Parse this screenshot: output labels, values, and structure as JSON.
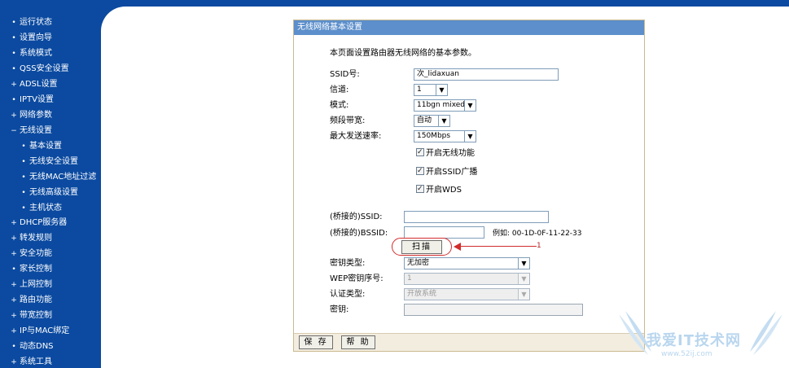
{
  "sidebar": {
    "items": [
      {
        "bullet": "•",
        "label": "运行状态"
      },
      {
        "bullet": "•",
        "label": "设置向导"
      },
      {
        "bullet": "•",
        "label": "系统模式"
      },
      {
        "bullet": "•",
        "label": "QSS安全设置"
      },
      {
        "bullet": "+",
        "label": "ADSL设置"
      },
      {
        "bullet": "•",
        "label": "IPTV设置"
      },
      {
        "bullet": "+",
        "label": "网络参数"
      },
      {
        "bullet": "−",
        "label": "无线设置"
      },
      {
        "bullet": "•",
        "label": "基本设置"
      },
      {
        "bullet": "•",
        "label": "无线安全设置"
      },
      {
        "bullet": "•",
        "label": "无线MAC地址过滤"
      },
      {
        "bullet": "•",
        "label": "无线高级设置"
      },
      {
        "bullet": "•",
        "label": "主机状态"
      },
      {
        "bullet": "+",
        "label": "DHCP服务器"
      },
      {
        "bullet": "+",
        "label": "转发规则"
      },
      {
        "bullet": "+",
        "label": "安全功能"
      },
      {
        "bullet": "•",
        "label": "家长控制"
      },
      {
        "bullet": "+",
        "label": "上网控制"
      },
      {
        "bullet": "+",
        "label": "路由功能"
      },
      {
        "bullet": "+",
        "label": "带宽控制"
      },
      {
        "bullet": "+",
        "label": "IP与MAC绑定"
      },
      {
        "bullet": "•",
        "label": "动态DNS"
      },
      {
        "bullet": "+",
        "label": "系统工具"
      }
    ]
  },
  "panel": {
    "title": "无线网络基本设置",
    "intro": "本页面设置路由器无线网络的基本参数。"
  },
  "form": {
    "ssid": {
      "label": "SSID号:",
      "value": "次_lidaxuan"
    },
    "channel": {
      "label": "信道:",
      "value": "1"
    },
    "mode": {
      "label": "模式:",
      "value": "11bgn mixed"
    },
    "bandwidth": {
      "label": "频段带宽:",
      "value": "自动"
    },
    "max_rate": {
      "label": "最大发送速率:",
      "value": "150Mbps"
    },
    "enable_wireless": "开启无线功能",
    "enable_ssid_broadcast": "开启SSID广播",
    "enable_wds": "开启WDS",
    "bridged_ssid": {
      "label": "(桥接的)SSID:",
      "value": ""
    },
    "bridged_bssid": {
      "label": "(桥接的)BSSID:",
      "value": "",
      "example": "例如: 00-1D-0F-11-22-33"
    },
    "scan_button": "扫描",
    "key_type": {
      "label": "密钥类型:",
      "value": "无加密"
    },
    "wep_index": {
      "label": "WEP密钥序号:",
      "value": "1"
    },
    "auth_type": {
      "label": "认证类型:",
      "value": "开放系统"
    },
    "key": {
      "label": "密钥:",
      "value": ""
    }
  },
  "annotation": {
    "number": "1",
    "color": "#d22c2c"
  },
  "buttons": {
    "save": "保 存",
    "help": "帮 助"
  },
  "watermark": {
    "text": "我爱IT技术网",
    "url": "www.52ij.com"
  },
  "colors": {
    "nav_bg": "#0b4aa0",
    "title_bar": "#5c8fcb",
    "panel_border": "#c9b98e"
  }
}
